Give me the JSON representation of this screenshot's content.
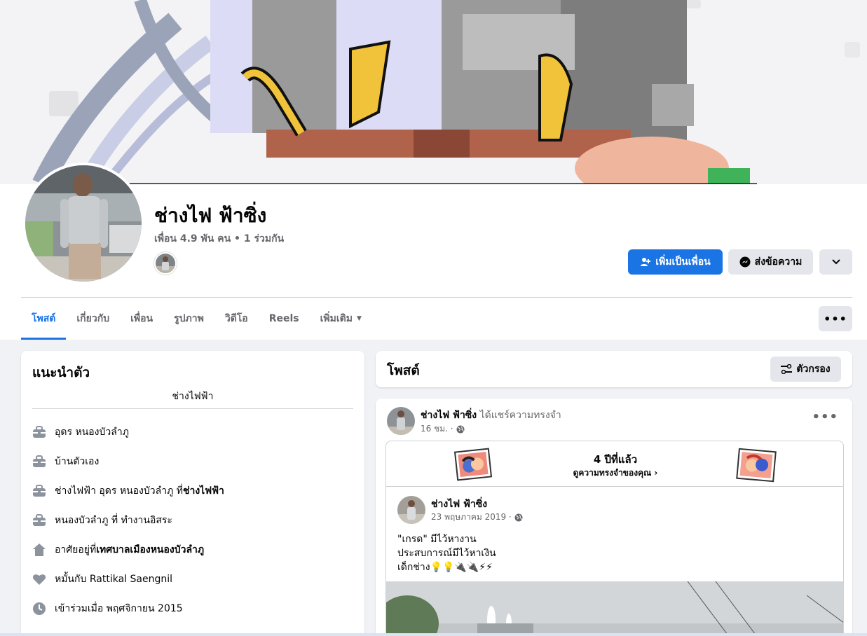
{
  "profile": {
    "name": "ช่างไฟ ฟ้าซิ่ง",
    "friends_line": "เพื่อน 4.9 พัน คน • 1 ร่วมกัน"
  },
  "actions": {
    "add_friend": "เพิ่มเป็นเพื่อน",
    "message": "ส่งข้อความ",
    "more_icon": "chevron-down-icon"
  },
  "tabs": [
    {
      "label": "โพสต์",
      "active": true
    },
    {
      "label": "เกี่ยวกับ",
      "active": false
    },
    {
      "label": "เพื่อน",
      "active": false
    },
    {
      "label": "รูปภาพ",
      "active": false
    },
    {
      "label": "วิดีโอ",
      "active": false
    },
    {
      "label": "Reels",
      "active": false
    },
    {
      "label": "เพิ่มเติม",
      "active": false
    }
  ],
  "tabs_more": "•••",
  "intro": {
    "title": "แนะนำตัว",
    "bio": "ช่างไฟฟ้า",
    "items": [
      {
        "icon": "briefcase-icon",
        "text": "อุดร หนองบัวลำภู",
        "bold": ""
      },
      {
        "icon": "briefcase-icon",
        "text": "บ้านตัวเอง",
        "bold": ""
      },
      {
        "icon": "briefcase-icon",
        "text": "ช่างไฟฟ้า อุดร หนองบัวลำภู ที่ ",
        "bold": "ช่างไฟฟ้า"
      },
      {
        "icon": "briefcase-icon",
        "text": "หนองบัวลำภู ที่ ทำงานอิสระ",
        "bold": ""
      },
      {
        "icon": "home-icon",
        "text": "อาศัยอยู่ที่ ",
        "bold": "เทศบาลเมืองหนองบัวลำภู"
      },
      {
        "icon": "heart-icon",
        "text": "หมั้นกับ Rattikal Saengnil",
        "bold": ""
      },
      {
        "icon": "clock-icon",
        "text": "เข้าร่วมเมื่อ พฤศจิกายน 2015",
        "bold": ""
      }
    ]
  },
  "posts_header": {
    "title": "โพสต์",
    "filter": "ตัวกรอง"
  },
  "post": {
    "author": "ช่างไฟ ฟ้าซิ่ง",
    "action": " ได้แชร์ความทรงจำ",
    "time": "16 ชม. ·",
    "menu": "•••",
    "memory": {
      "years_ago": "4 ปีที่แล้ว",
      "link": "ดูความทรงจำของคุณ"
    },
    "inner": {
      "author": "ช่างไฟ ฟ้าซิ่ง",
      "date": "23 พฤษภาคม 2019 ·",
      "lines": [
        "\"เกรด\" มีไว้หางาน",
        "ประสบการณ์มีไว้หาเงิน",
        "เด็กช่าง💡💡🔌🔌⚡⚡"
      ]
    }
  },
  "colors": {
    "brand_blue": "#1b74e4",
    "secondary_gray": "#e4e6eb",
    "text_muted": "#65676b",
    "page_bg": "#f0f2f5"
  }
}
